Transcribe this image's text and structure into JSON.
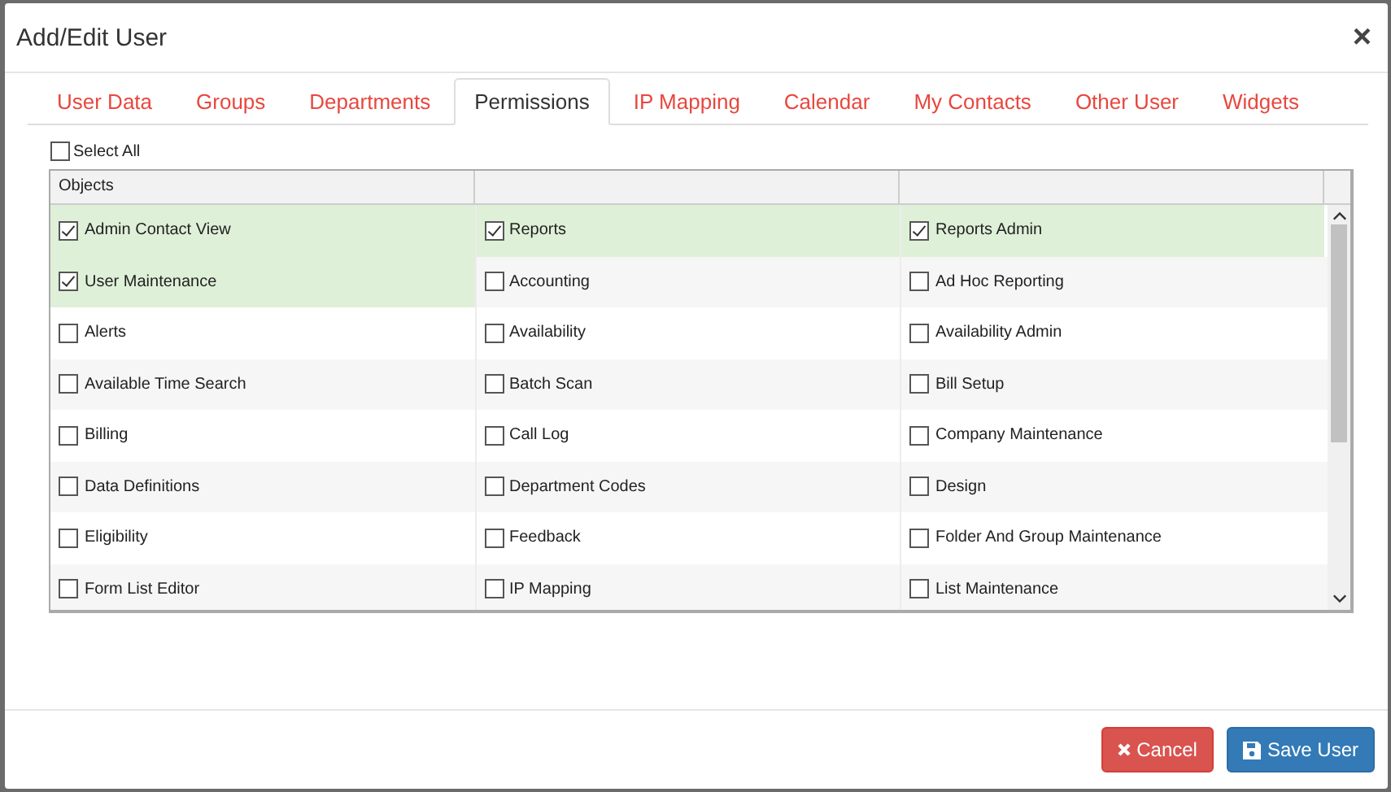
{
  "dialog": {
    "title": "Add/Edit User",
    "close": "×"
  },
  "tabs": [
    {
      "label": "User Data",
      "selected": false
    },
    {
      "label": "Groups",
      "selected": false
    },
    {
      "label": "Departments",
      "selected": false
    },
    {
      "label": "Permissions",
      "selected": true
    },
    {
      "label": "IP Mapping",
      "selected": false
    },
    {
      "label": "Calendar",
      "selected": false
    },
    {
      "label": "My Contacts",
      "selected": false
    },
    {
      "label": "Other User",
      "selected": false
    },
    {
      "label": "Widgets",
      "selected": false
    }
  ],
  "select_all": {
    "label": "Select All",
    "checked": false
  },
  "table": {
    "columns": [
      "Objects"
    ],
    "rows": [
      [
        {
          "label": "Admin Contact View",
          "checked": true
        },
        {
          "label": "Reports",
          "checked": true
        },
        {
          "label": "Reports Admin",
          "checked": true
        }
      ],
      [
        {
          "label": "User Maintenance",
          "checked": true
        },
        {
          "label": "Accounting",
          "checked": false
        },
        {
          "label": "Ad Hoc Reporting",
          "checked": false
        }
      ],
      [
        {
          "label": "Alerts",
          "checked": false
        },
        {
          "label": "Availability",
          "checked": false
        },
        {
          "label": "Availability Admin",
          "checked": false
        }
      ],
      [
        {
          "label": "Available Time Search",
          "checked": false
        },
        {
          "label": "Batch Scan",
          "checked": false
        },
        {
          "label": "Bill Setup",
          "checked": false
        }
      ],
      [
        {
          "label": "Billing",
          "checked": false
        },
        {
          "label": "Call Log",
          "checked": false
        },
        {
          "label": "Company Maintenance",
          "checked": false
        }
      ],
      [
        {
          "label": "Data Definitions",
          "checked": false
        },
        {
          "label": "Department Codes",
          "checked": false
        },
        {
          "label": "Design",
          "checked": false
        }
      ],
      [
        {
          "label": "Eligibility",
          "checked": false
        },
        {
          "label": "Feedback",
          "checked": false
        },
        {
          "label": "Folder And Group Maintenance",
          "checked": false
        }
      ],
      [
        {
          "label": "Form List Editor",
          "checked": false
        },
        {
          "label": "IP Mapping",
          "checked": false
        },
        {
          "label": "List Maintenance",
          "checked": false
        }
      ]
    ]
  },
  "buttons": [
    {
      "kind": "cancel",
      "label": "Cancel"
    },
    {
      "kind": "save",
      "label": "Save User"
    }
  ]
}
